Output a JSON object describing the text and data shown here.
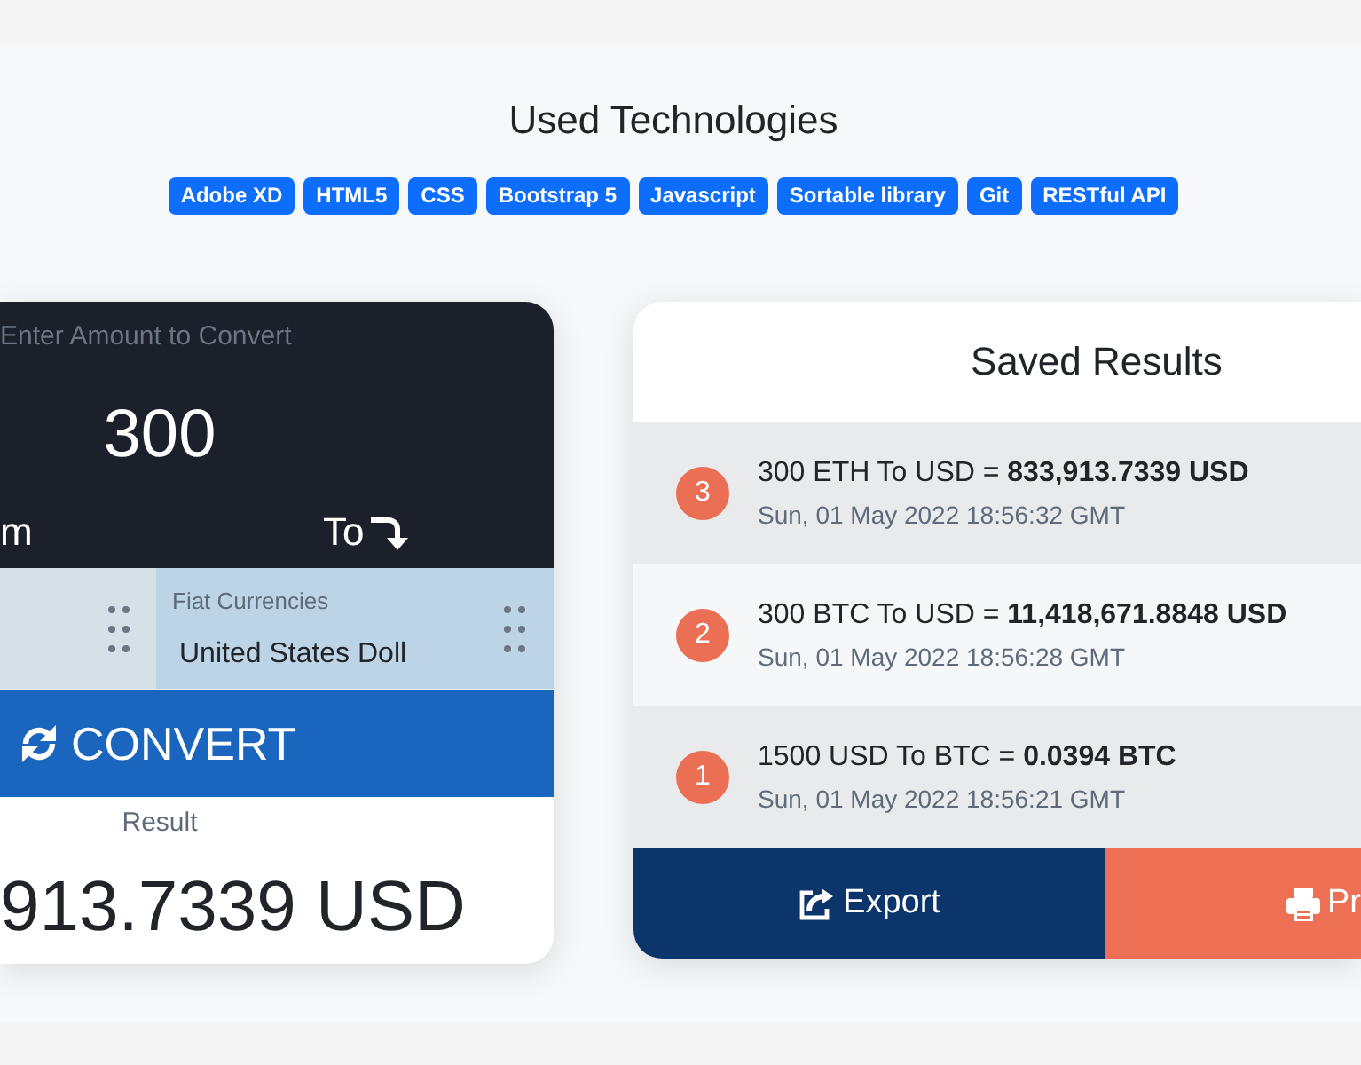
{
  "technologies": {
    "title": "Used Technologies",
    "badges": [
      "Adobe XD",
      "HTML5",
      "CSS",
      "Bootstrap 5",
      "Javascript",
      "Sortable library",
      "Git",
      "RESTful API"
    ]
  },
  "converter": {
    "amount_label": "Enter Amount to Convert",
    "amount": "300",
    "from_label": "m",
    "to_label": "To",
    "to_select": {
      "label": "Fiat Currencies",
      "value": "United States Doll"
    },
    "convert_button": "CONVERT",
    "result_label": "Result",
    "result": "913.7339 USD"
  },
  "saved_results": {
    "title": "Saved Results",
    "items": [
      {
        "number": "3",
        "conversion": "300 ETH To USD = **833,913.7339 USD**",
        "timestamp": "Sun, 01 May 2022 18:56:32 GMT"
      },
      {
        "number": "2",
        "conversion": "300 BTC To USD = **11,418,671.8848 USD**",
        "timestamp": "Sun, 01 May 2022 18:56:28 GMT"
      },
      {
        "number": "1",
        "conversion": "1500 USD To BTC = **0.0394 BTC**",
        "timestamp": "Sun, 01 May 2022 18:56:21 GMT"
      }
    ],
    "buttons": [
      {
        "kind": "export",
        "label": "Export"
      },
      {
        "kind": "print",
        "label": "Pr"
      }
    ]
  }
}
